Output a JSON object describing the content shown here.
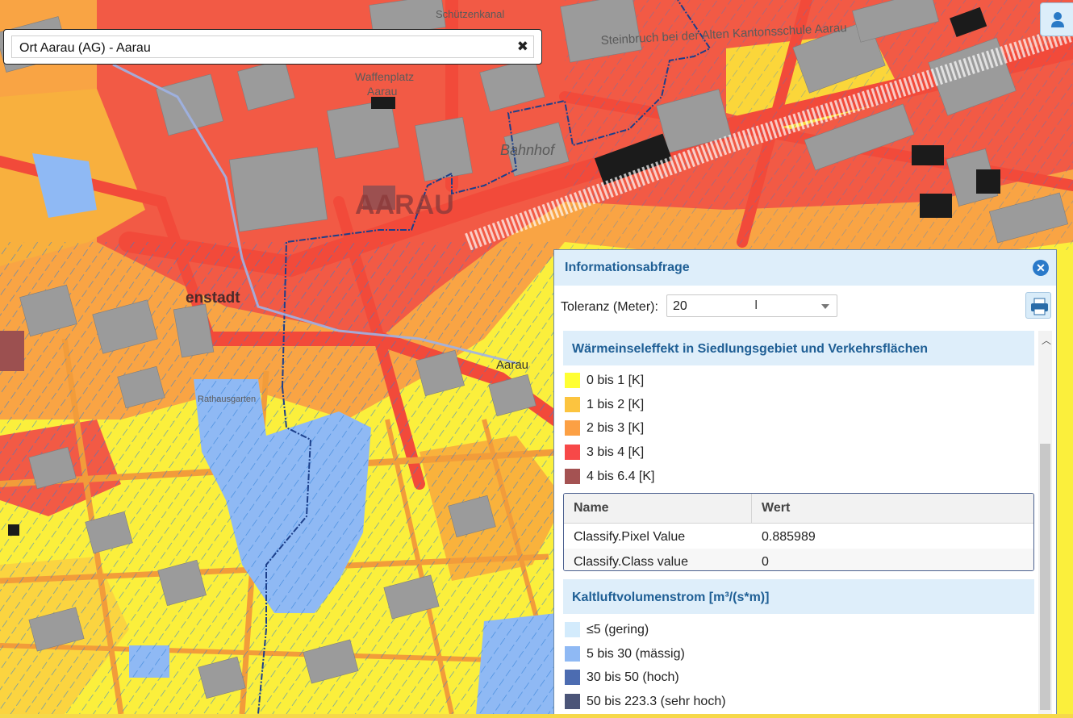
{
  "search": {
    "value": "Ort Aarau (AG) - Aarau",
    "clear_icon": "✖"
  },
  "map_labels": [
    {
      "text": "Schützenkanal"
    },
    {
      "text": "Steinbruch bei der Alten Kantonsschule Aarau"
    },
    {
      "text": "Waffenplatz"
    },
    {
      "text": "Aarau"
    },
    {
      "text": "AARAU"
    },
    {
      "text": "Bahnhof"
    },
    {
      "text": "enstadt"
    },
    {
      "text": "Aarau"
    },
    {
      "text": "Rathausgarten"
    }
  ],
  "panel": {
    "title": "Informationsabfrage",
    "tolerance_label": "Toleranz (Meter):",
    "tolerance_value": "20",
    "sections": [
      {
        "title": "Wärmeinseleffekt in Siedlungsgebiet und Verkehrsflächen",
        "legend": [
          {
            "label": "0 bis 1 [K]",
            "color": "#ffff33"
          },
          {
            "label": "1 bis 2 [K]",
            "color": "#fcc43f"
          },
          {
            "label": "2 bis 3 [K]",
            "color": "#fca044"
          },
          {
            "label": "3 bis 4 [K]",
            "color": "#f74848"
          },
          {
            "label": "4 bis 6.4 [K]",
            "color": "#a45252"
          }
        ],
        "table": {
          "headers": [
            "Name",
            "Wert"
          ],
          "rows": [
            [
              "Classify.Pixel Value",
              "0.885989"
            ],
            [
              "Classify.Class value",
              "0"
            ]
          ]
        }
      },
      {
        "title": "Kaltluftvolumenstrom [m³/(s*m)]",
        "legend": [
          {
            "label": "≤5 (gering)",
            "color": "#d3ebfc"
          },
          {
            "label": "5 bis 30 (mässig)",
            "color": "#8fb9f4"
          },
          {
            "label": "30 bis 50 (hoch)",
            "color": "#4c6cb1"
          },
          {
            "label": "50 bis 223.3 (sehr hoch)",
            "color": "#4b5578"
          }
        ]
      }
    ]
  },
  "colors": {
    "accent": "#1f5f95",
    "panel_header": "#deeefa",
    "close": "#2979c9"
  }
}
